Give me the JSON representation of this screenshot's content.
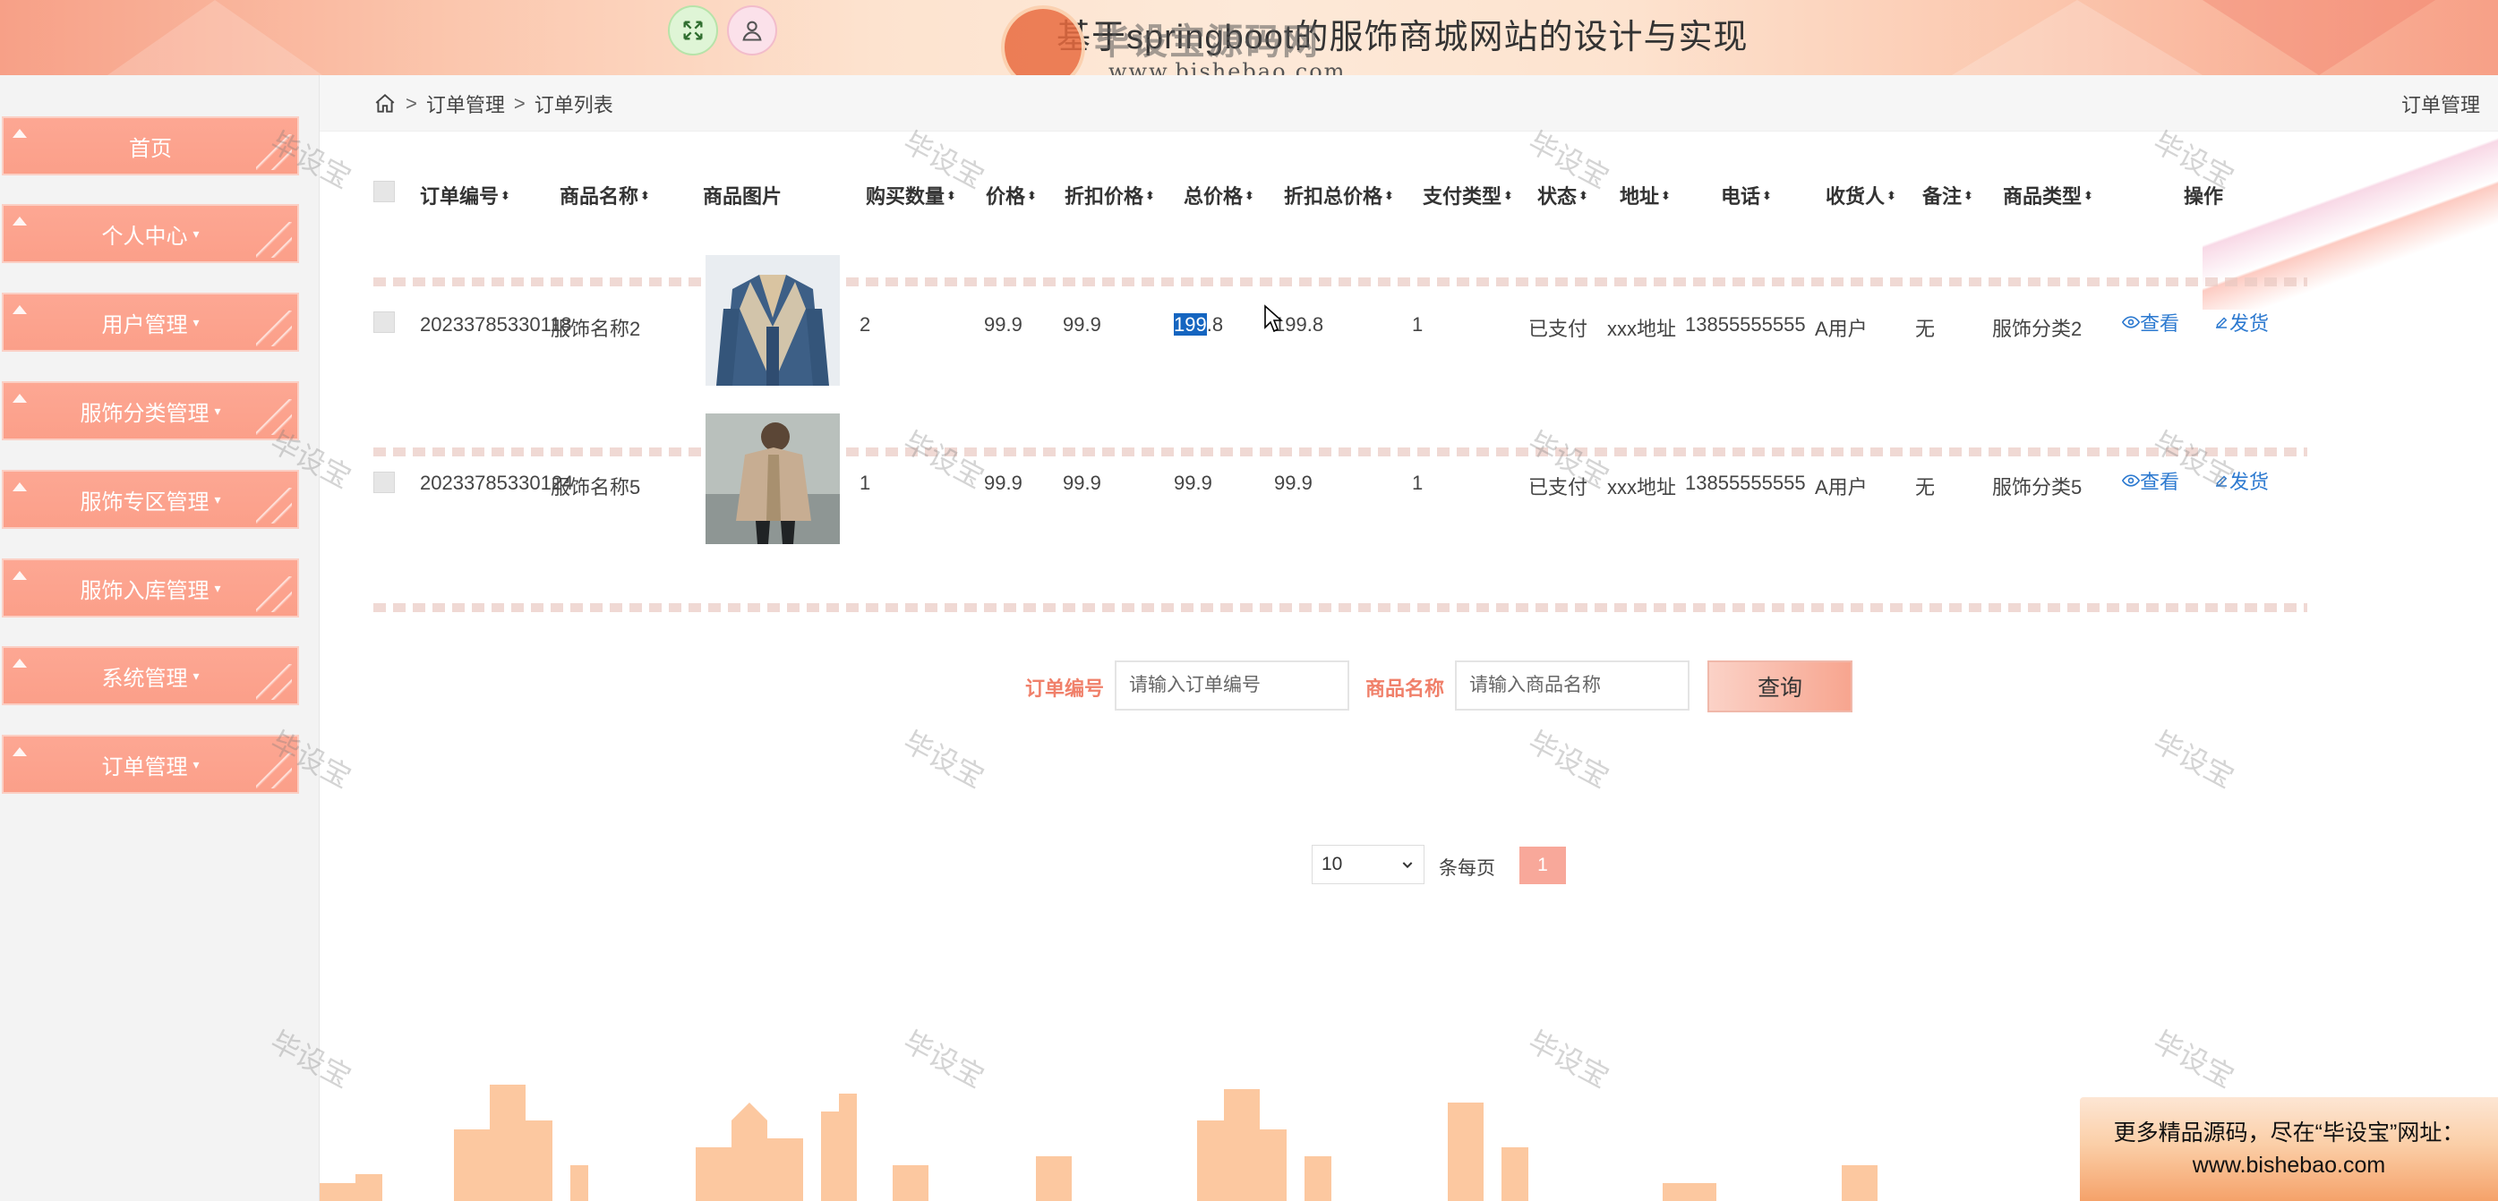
{
  "header": {
    "site_title": "基于springboot的服饰商城网站的设计与实现",
    "logo_text": "毕设宝源码网",
    "logo_url": "www.bishebao.com",
    "fullscreen_icon": "expand-icon",
    "user_icon": "user-icon",
    "accent": "#f7a087"
  },
  "sidebar": {
    "items": [
      {
        "label": "首页",
        "caret": ""
      },
      {
        "label": "个人中心",
        "caret": "▾"
      },
      {
        "label": "用户管理",
        "caret": "▾"
      },
      {
        "label": "服饰分类管理",
        "caret": "▾"
      },
      {
        "label": "服饰专区管理",
        "caret": "▾"
      },
      {
        "label": "服饰入库管理",
        "caret": "▾"
      },
      {
        "label": "系统管理",
        "caret": "▾"
      },
      {
        "label": "订单管理",
        "caret": "▾"
      }
    ]
  },
  "breadcrumb": {
    "level1": "订单管理",
    "level2": "订单列表",
    "separator": ">",
    "right_label": "订单管理"
  },
  "table": {
    "headers": {
      "order_no": "订单编号",
      "goods_name": "商品名称",
      "goods_image": "商品图片",
      "quantity": "购买数量",
      "price": "价格",
      "discount_price": "折扣价格",
      "total_price": "总价格",
      "discount_total": "折扣总价格",
      "pay_type": "支付类型",
      "status": "状态",
      "address": "地址",
      "phone": "电话",
      "receiver": "收货人",
      "remark": "备注",
      "goods_type": "商品类型",
      "actions": "操作"
    },
    "sort_glyph": "⬍",
    "rows": [
      {
        "order_no": "20233785330118",
        "goods_name": "服饰名称2",
        "quantity": "2",
        "price": "99.9",
        "discount_price": "99.9",
        "total_price_selected": "199",
        "total_price_rest": ".8",
        "discount_total": "199.8",
        "pay_type": "1",
        "status": "已支付",
        "address": "xxx地址",
        "phone": "13855555555",
        "receiver": "A用户",
        "remark": "无",
        "goods_type": "服饰分类2",
        "view": "查看",
        "ship": "发货",
        "image": "denim-jacket"
      },
      {
        "order_no": "20233785330124",
        "goods_name": "服饰名称5",
        "quantity": "1",
        "price": "99.9",
        "discount_price": "99.9",
        "total_price_selected": "",
        "total_price_rest": "99.9",
        "discount_total": "99.9",
        "pay_type": "1",
        "status": "已支付",
        "address": "xxx地址",
        "phone": "13855555555",
        "receiver": "A用户",
        "remark": "无",
        "goods_type": "服饰分类5",
        "view": "查看",
        "ship": "发货",
        "image": "beige-coat"
      }
    ]
  },
  "search": {
    "order_label": "订单编号",
    "order_placeholder": "请输入订单编号",
    "goods_label": "商品名称",
    "goods_placeholder": "请输入商品名称",
    "button": "查询"
  },
  "pager": {
    "page_size": "10",
    "per_page_label": "条每页",
    "current_page": "1"
  },
  "watermark": "毕设宝",
  "ad": {
    "line1": "更多精品源码，尽在“毕设宝”网址：",
    "line2": "www.bishebao.com"
  }
}
